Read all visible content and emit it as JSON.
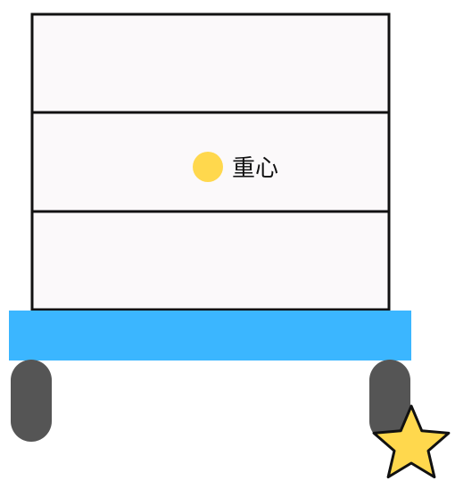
{
  "center_of_gravity": {
    "label": "重心",
    "marker_color": "#FFD84D"
  },
  "stack": {
    "box_count": 3,
    "box_fill": "#FBF9FA",
    "outline_color": "#111111"
  },
  "cart": {
    "platform_color": "#3BB6FF",
    "wheel_color": "#555555"
  },
  "star_marker": {
    "fill": "#FFD84D",
    "outline": "#111111",
    "icon": "star-icon"
  }
}
